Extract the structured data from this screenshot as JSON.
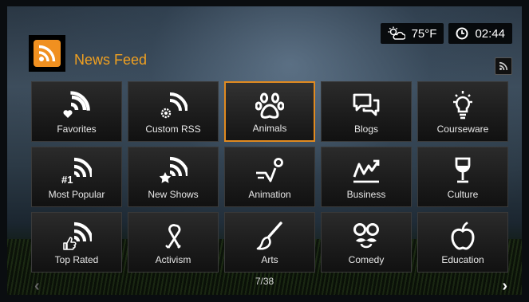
{
  "status": {
    "weather_icon": "partly-cloudy-icon",
    "temperature": "75°F",
    "clock_icon": "clock-icon",
    "time": "02:44"
  },
  "header": {
    "title": "News Feed",
    "logo_icon": "rss-icon",
    "accent_color": "#f0a020"
  },
  "grid": {
    "selected_index": 2,
    "tiles": [
      {
        "label": "Favorites",
        "icon": "rss-heart-icon"
      },
      {
        "label": "Custom RSS",
        "icon": "rss-gear-icon"
      },
      {
        "label": "Animals",
        "icon": "paw-icon"
      },
      {
        "label": "Blogs",
        "icon": "chat-bubbles-icon"
      },
      {
        "label": "Courseware",
        "icon": "lightbulb-icon"
      },
      {
        "label": "Most Popular",
        "icon": "rss-number-one-icon"
      },
      {
        "label": "New Shows",
        "icon": "rss-star-icon"
      },
      {
        "label": "Animation",
        "icon": "bouncing-ball-icon"
      },
      {
        "label": "Business",
        "icon": "trend-chart-icon"
      },
      {
        "label": "Culture",
        "icon": "wine-glass-icon"
      },
      {
        "label": "Top Rated",
        "icon": "rss-thumbs-up-icon"
      },
      {
        "label": "Activism",
        "icon": "ribbon-icon"
      },
      {
        "label": "Arts",
        "icon": "paintbrush-icon"
      },
      {
        "label": "Comedy",
        "icon": "glasses-mustache-icon"
      },
      {
        "label": "Education",
        "icon": "apple-icon"
      }
    ]
  },
  "pager": {
    "text": "7/38"
  },
  "nav": {
    "prev": "‹",
    "next": "›"
  }
}
